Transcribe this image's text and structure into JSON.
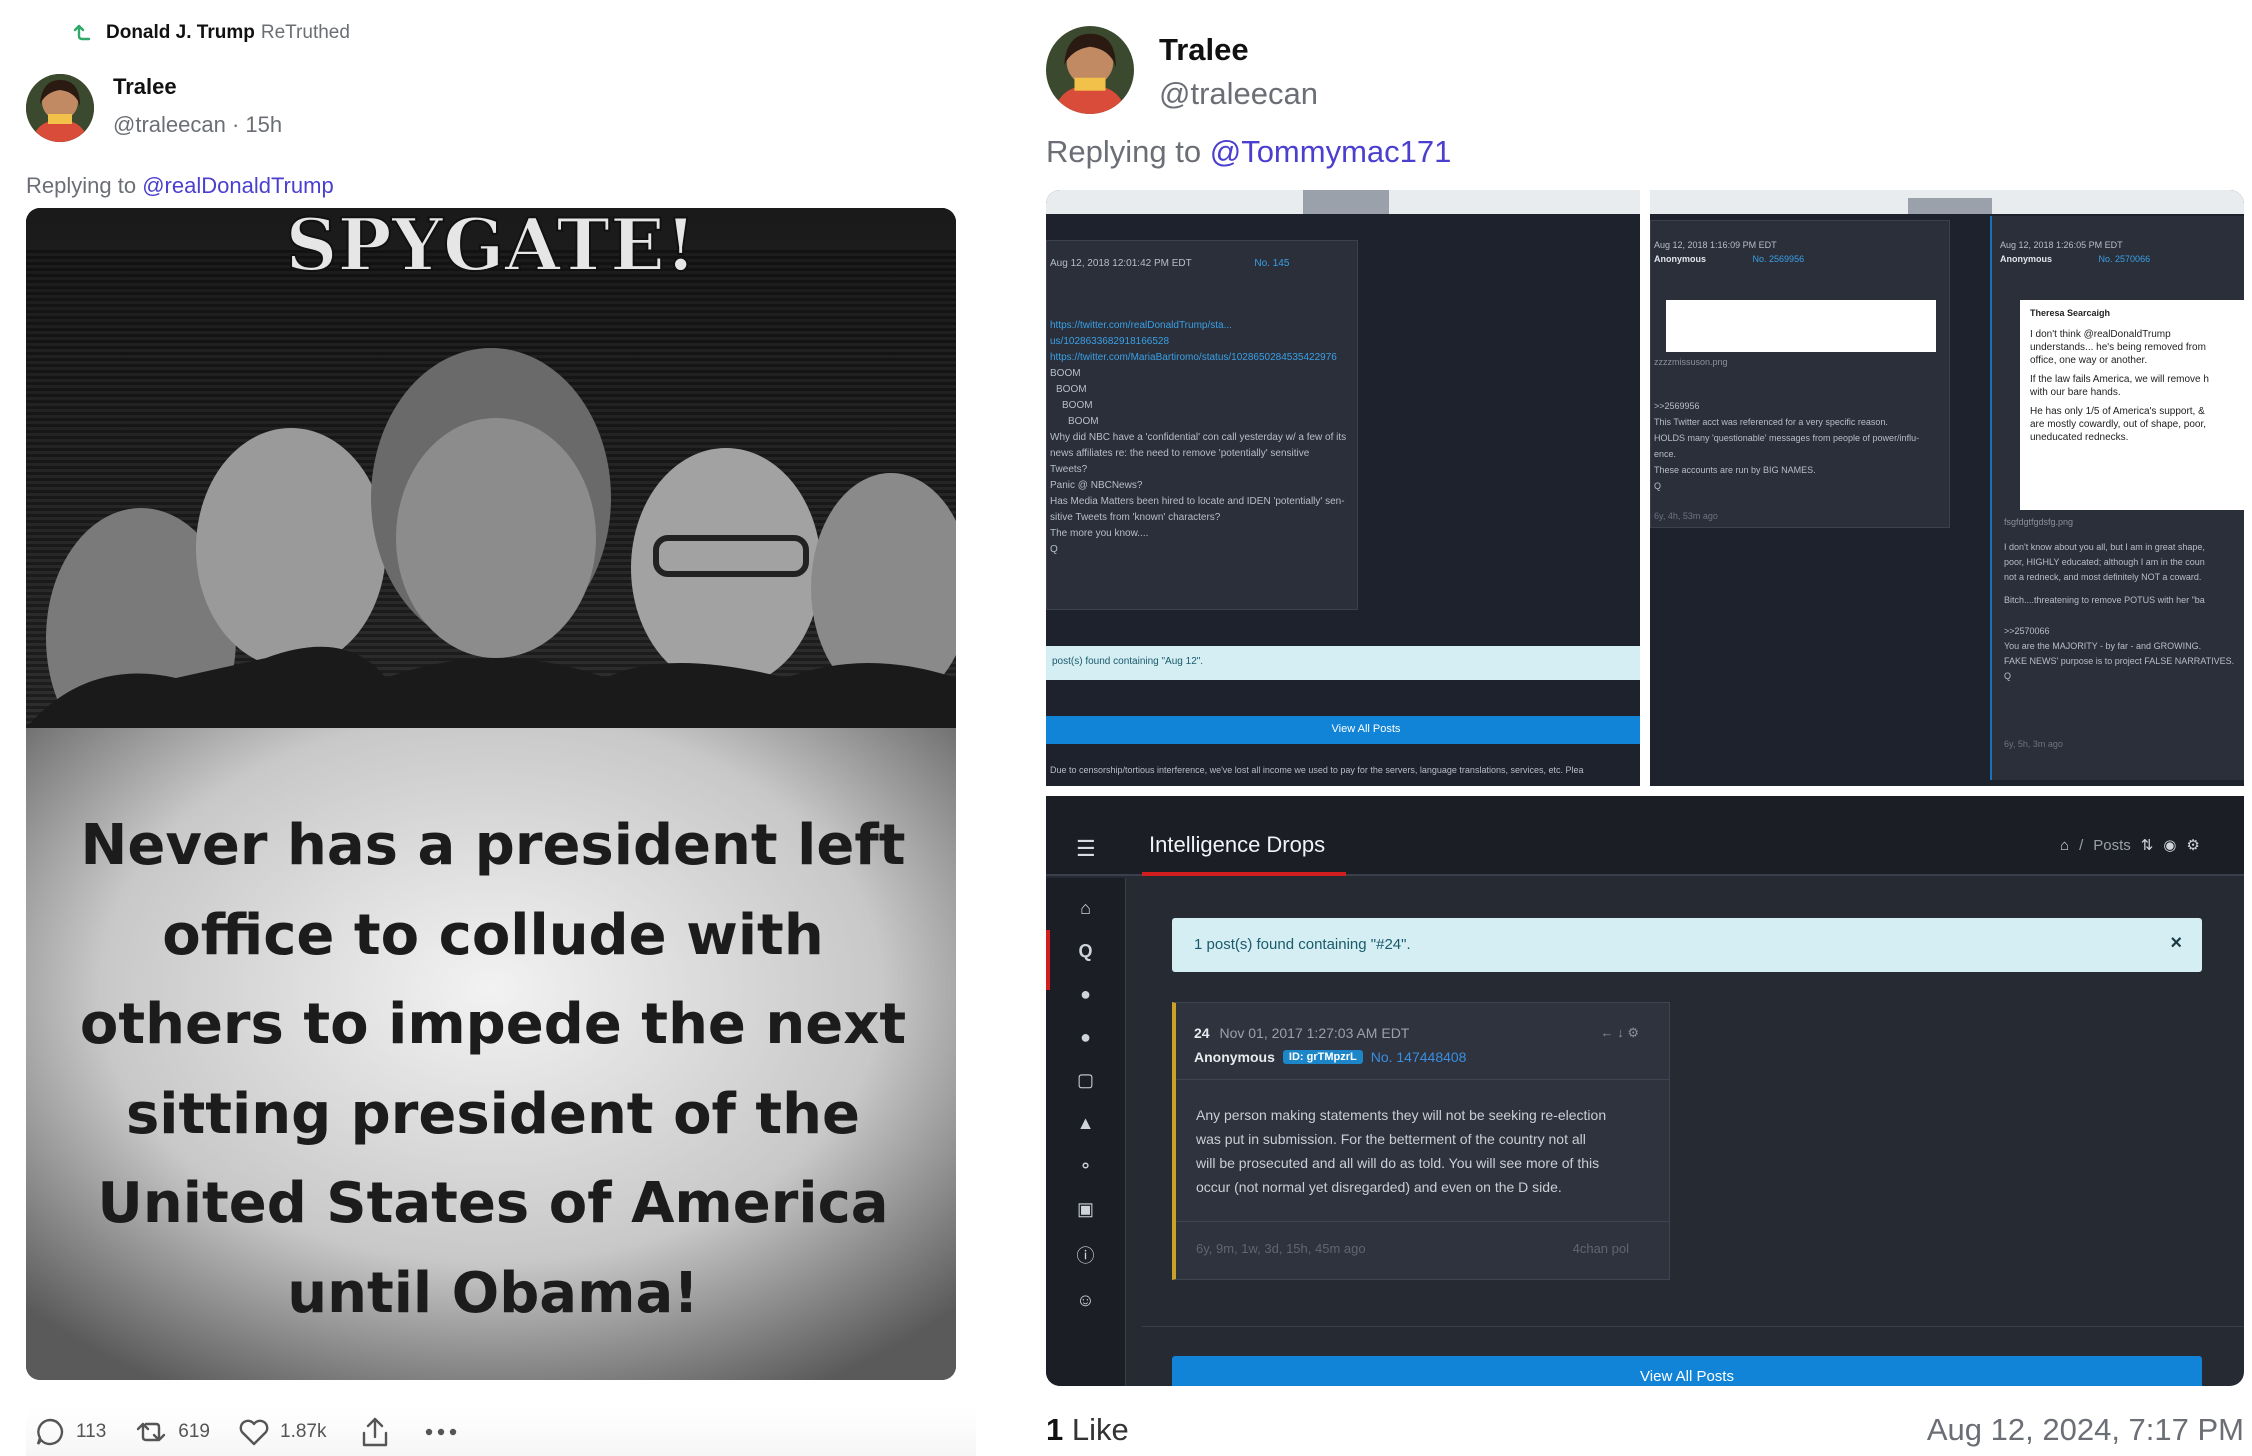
{
  "left_post": {
    "retruth": {
      "author": "Donald J. Trump",
      "action": "ReTruthed"
    },
    "user": {
      "name": "Tralee",
      "handle": "@traleecan",
      "age": "· 15h"
    },
    "reply": {
      "prefix": "Replying to",
      "target": "@realDonaldTrump"
    },
    "meme": {
      "headline": "SPYGATE!",
      "lines": [
        "Never has a president left",
        "office to collude with",
        "others to impede the next",
        "sitting president of the",
        "United States of America",
        "until Obama!"
      ]
    },
    "actions": {
      "replies": "113",
      "retruths": "619",
      "likes": "1.87k"
    }
  },
  "right_post": {
    "user": {
      "name": "Tralee",
      "handle": "@traleecan"
    },
    "reply": {
      "prefix": "Replying to",
      "target": "@Tommymac171"
    },
    "footer": {
      "likes_count": "1",
      "likes_label": "Like",
      "date": "Aug 12, 2024, 7:17 PM"
    }
  },
  "screenshot_a": {
    "timestamp": "Aug 12, 2018 12:01:42 PM EDT",
    "post_no": "No. 145",
    "links": [
      "https://twitter.com/realDonaldTrump/sta...",
      "us/1028633682918166528",
      "https://twitter.com/MariaBartiromo/status/1028650284535422976"
    ],
    "boom": [
      "BOOM",
      "BOOM",
      "BOOM",
      "BOOM"
    ],
    "body": [
      "Why did NBC have a 'confidential' con call yesterday w/ a few of its",
      "news affiliates re: the need to remove 'potentially' sensitive",
      "Tweets?",
      "Panic @ NBCNews?",
      "Has Media Matters been hired to locate and IDEN 'potentially' sen-",
      "sitive Tweets from 'known' characters?",
      "The more you know....",
      "Q"
    ],
    "found": "post(s) found containing \"Aug 12\".",
    "view_all": "View All Posts",
    "censorship": "Due to censorship/tortious interference, we've lost all income we used to pay for the servers, language translations, services, etc. Plea"
  },
  "screenshot_b": {
    "post1": {
      "timestamp": "Aug 12, 2018 1:16:09 PM EDT",
      "author": "Anonymous",
      "post_no": "No. 2569956",
      "filename": "zzzzmissuson.png",
      "body": [
        ">>2569956",
        "This Twitter acct was referenced for a very specific reason.",
        "HOLDS many 'questionable' messages from people of power/influ-",
        "ence.",
        "These accounts are run by BIG NAMES.",
        "Q"
      ],
      "age": "6y, 4h, 53m ago"
    },
    "post2": {
      "timestamp": "Aug 12, 2018 1:26:05 PM EDT",
      "author": "Anonymous",
      "post_no": "No. 2570066",
      "tweet_author": "Theresa Searcaigh",
      "tweet_lines": [
        "I don't think @realDonaldTrump",
        "understands... he's being removed from",
        "office, one way or another.",
        "If the law fails America, we will remove h",
        "with our bare hands.",
        "He has only 1/5 of America's support, &",
        "are mostly cowardly, out of shape, poor,",
        "uneducated rednecks."
      ],
      "filename": "fsgfdgtfgdsfg.png",
      "body": [
        "I don't know about you all, but I am in great shape,",
        "poor, HIGHLY educated; although I am in the coun",
        "not a redneck, and most definitely NOT a coward.",
        "Bitch....threatening to remove POTUS with her \"ba",
        ">>2570066",
        "You are the MAJORITY - by far - and GROWING.",
        "FAKE NEWS' purpose is to project FALSE NARRATIVES.",
        "Q"
      ],
      "age": "6y, 5h, 3m ago"
    }
  },
  "screenshot_c": {
    "title": "Intelligence Drops",
    "breadcrumb": "Posts",
    "found": "1 post(s) found containing \"#24\".",
    "post": {
      "number": "24",
      "timestamp": "Nov 01, 2017 1:27:03 AM EDT",
      "author": "Anonymous",
      "id_badge": "ID: grTMpzrL",
      "post_no": "No. 147448408",
      "body": [
        "Any person making statements they will not be seeking re-election",
        "was put in submission. For the betterment of the country not all",
        "will be prosecuted and all will do as told. You will see more of this",
        "occur (not normal yet disregarded) and even on the D side."
      ],
      "age": "6y, 9m, 1w, 3d, 15h, 45m ago",
      "board": "4chan pol"
    },
    "view_all": "View All Posts"
  },
  "colors": {
    "accent": "#4b3fd0",
    "retruth_green": "#2fa86a",
    "dark_bg": "#1e222c",
    "info_bg": "#d4eef4",
    "blue_button": "#1184d8",
    "qred": "#d11f1f"
  }
}
